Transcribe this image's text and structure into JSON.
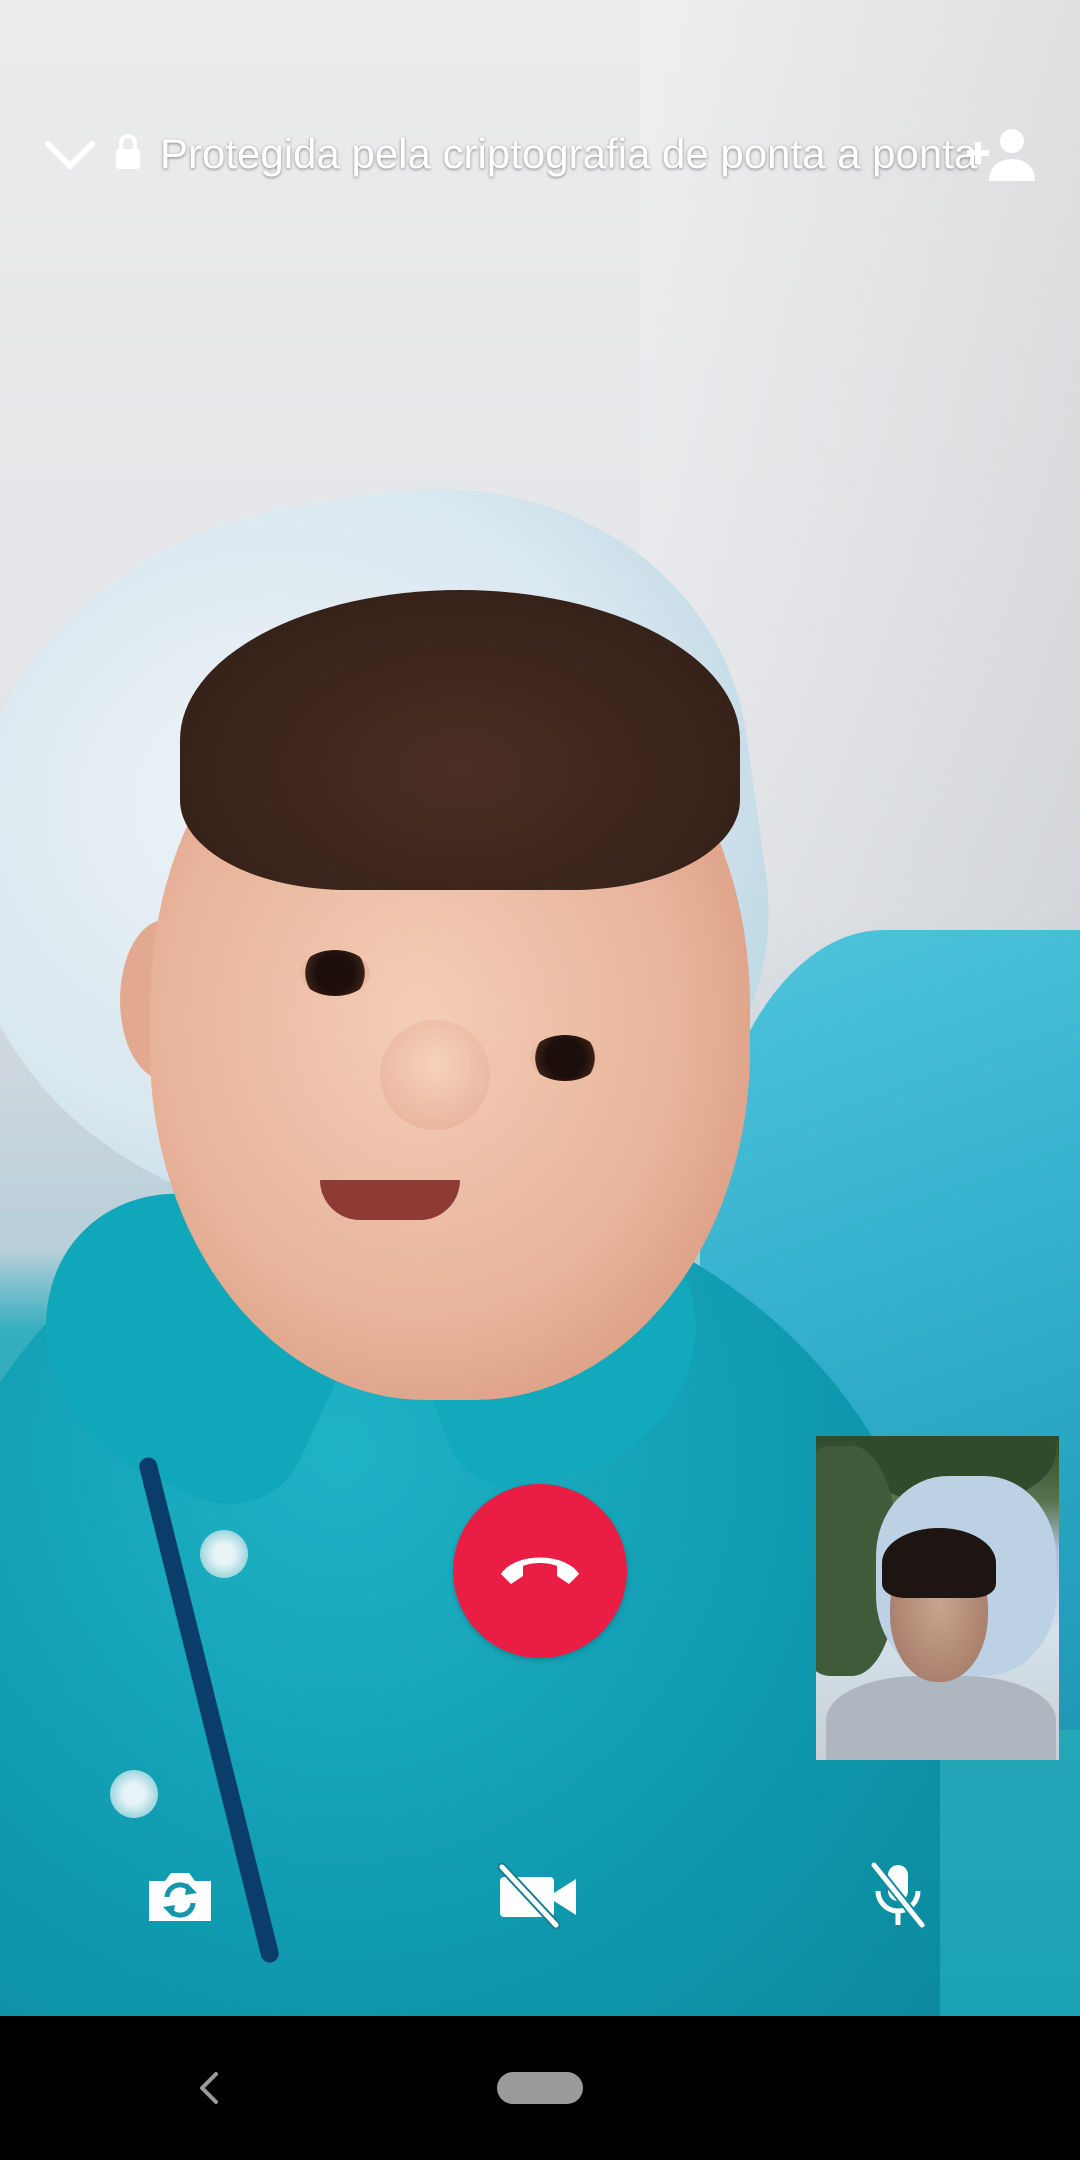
{
  "call": {
    "encryption_notice": "Protegida pela criptografia de ponta a ponta",
    "end_call_color": "#ea1d45"
  },
  "icons": {
    "collapse": "chevron-down-icon",
    "lock": "lock-icon",
    "add_participant": "add-person-icon",
    "end_call": "phone-hangup-icon",
    "flip_camera": "camera-flip-icon",
    "video_off": "video-off-icon",
    "mute": "mic-off-icon",
    "nav_back": "back-triangle-icon",
    "nav_home": "home-pill-icon"
  }
}
